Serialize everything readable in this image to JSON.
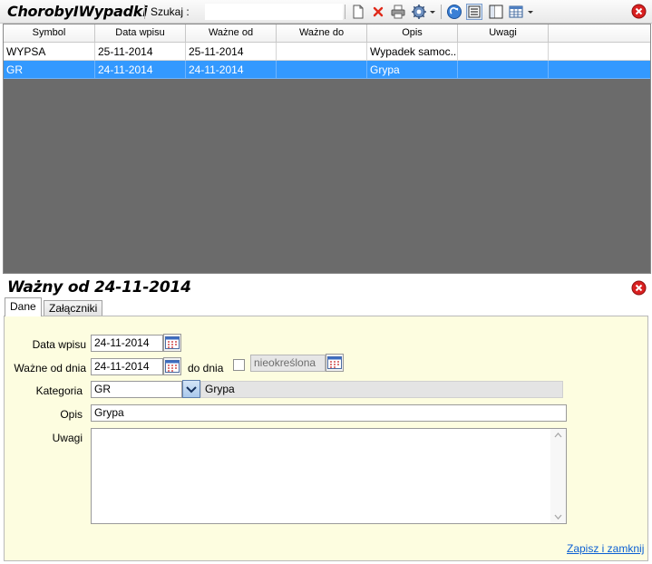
{
  "app": {
    "title": "ChorobyIWypadki"
  },
  "toolbar": {
    "search_label": "Szukaj :",
    "search_value": "",
    "icons": [
      "new-document-icon",
      "delete-icon",
      "print-icon",
      "settings-icon",
      "refresh-icon",
      "details-view-icon",
      "split-view-icon",
      "table-view-icon"
    ]
  },
  "grid": {
    "columns": [
      "Symbol",
      "Data wpisu",
      "Ważne od",
      "Ważne do",
      "Opis",
      "Uwagi"
    ],
    "rows": [
      {
        "symbol": "WYPSA",
        "data_wpisu": "25-11-2014",
        "wazne_od": "25-11-2014",
        "wazne_do": "",
        "opis": "Wypadek samoc...",
        "uwagi": ""
      },
      {
        "symbol": "GR",
        "data_wpisu": "24-11-2014",
        "wazne_od": "24-11-2014",
        "wazne_do": "",
        "opis": "Grypa",
        "uwagi": ""
      }
    ],
    "selected_row": 1
  },
  "detail": {
    "title": "Ważny od 24-11-2014",
    "tabs": [
      {
        "label": "Dane",
        "active": true
      },
      {
        "label": "Załączniki",
        "active": false
      }
    ],
    "form": {
      "data_wpisu_label": "Data wpisu",
      "data_wpisu_value": "24-11-2014",
      "wazne_od_label": "Ważne od dnia",
      "wazne_od_value": "24-11-2014",
      "do_dnia_label": "do dnia",
      "do_dnia_checked": false,
      "do_dnia_value": "nieokreślona",
      "kategoria_label": "Kategoria",
      "kategoria_code": "GR",
      "kategoria_name": "Grypa",
      "opis_label": "Opis",
      "opis_value": "Grypa",
      "uwagi_label": "Uwagi",
      "uwagi_value": ""
    },
    "save_close_label": "Zapisz i zamknij"
  },
  "colors": {
    "selection": "#3399ff",
    "panel_background": "#fdfde0",
    "grid_background": "#6b6b6b",
    "link": "#0b5fd3",
    "close_button": "#d92020"
  }
}
